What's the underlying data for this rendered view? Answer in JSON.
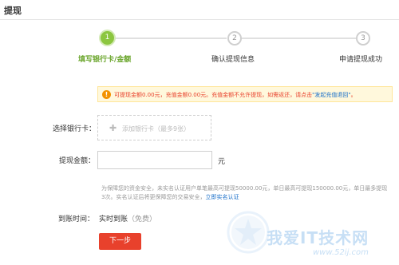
{
  "page": {
    "title": "提现"
  },
  "steps": [
    {
      "number": "1",
      "label": "填写银行卡/金额"
    },
    {
      "number": "2",
      "label": "确认提现信息"
    },
    {
      "number": "3",
      "label": "申请提现成功"
    }
  ],
  "notice": {
    "icon": "warning-icon",
    "text": "可提现金额0.00元，充值金额0.00元。充值金额不允许提现，如需返还，请点击",
    "link": "\"发起充值退回\"",
    "end": "。"
  },
  "form": {
    "bank_label": "选择银行卡：",
    "add_card_text": "添加银行卡（最多9张）",
    "amount_label": "提现金额：",
    "amount_value": "",
    "unit": "元",
    "hint": "为保障您的资金安全，未实名认证用户单笔最高可提现50000.00元，单日最高可提现150000.00元，单日最多提现3次。实名认证后将更保障您的交易安全，",
    "hint_link": "立即实名认证",
    "arrival_label": "到账时间：",
    "arrival_value": "实时到账",
    "arrival_note": "（免费）",
    "next_button": "下一步"
  },
  "watermark": {
    "title": "我爱IT技术网",
    "url": "www.52ij.com"
  },
  "colors": {
    "accent_green": "#8cc63f",
    "primary_red": "#e8412c",
    "link_blue": "#1a6fc9",
    "notice_bg": "#fff8dc"
  }
}
